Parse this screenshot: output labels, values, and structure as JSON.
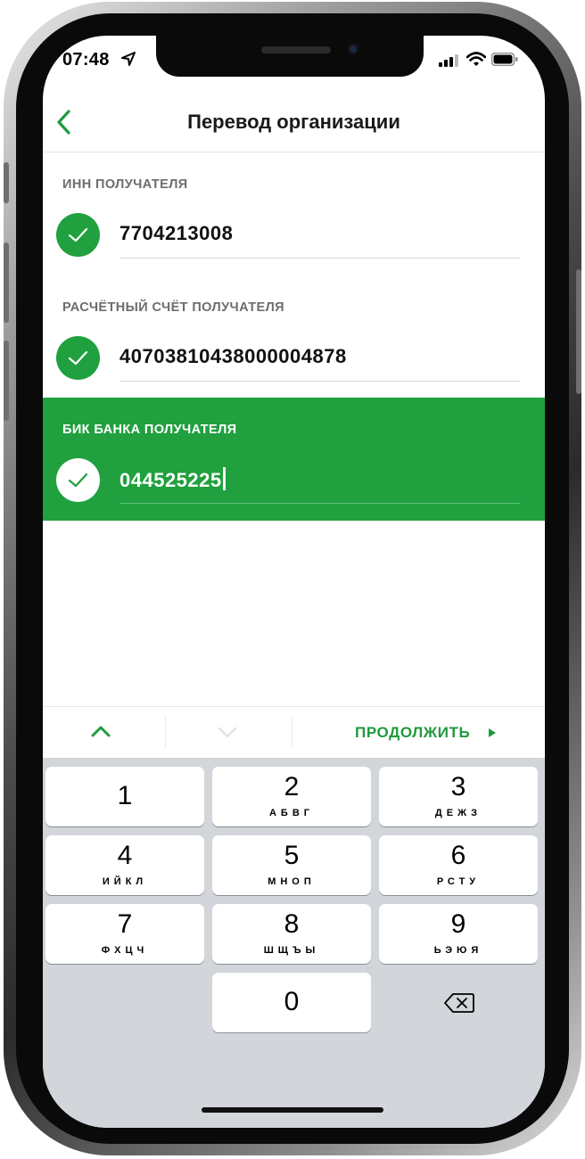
{
  "status_bar": {
    "time": "07:48"
  },
  "nav": {
    "title": "Перевод организации"
  },
  "fields": [
    {
      "label": "ИНН ПОЛУЧАТЕЛЯ",
      "value": "7704213008"
    },
    {
      "label": "РАСЧЁТНЫЙ СЧЁТ ПОЛУЧАТЕЛЯ",
      "value": "40703810438000004878"
    },
    {
      "label": "БИК БАНКА ПОЛУЧАТЕЛЯ",
      "value": "044525225"
    }
  ],
  "accessory": {
    "continue_label": "ПРОДОЛЖИТЬ"
  },
  "keypad": {
    "keys": [
      {
        "num": "1",
        "letters": ""
      },
      {
        "num": "2",
        "letters": "АБВГ"
      },
      {
        "num": "3",
        "letters": "ДЕЖЗ"
      },
      {
        "num": "4",
        "letters": "ИЙКЛ"
      },
      {
        "num": "5",
        "letters": "МНОП"
      },
      {
        "num": "6",
        "letters": "РСТУ"
      },
      {
        "num": "7",
        "letters": "ФХЦЧ"
      },
      {
        "num": "8",
        "letters": "ШЩЪЫ"
      },
      {
        "num": "9",
        "letters": "ЬЭЮЯ"
      },
      {
        "num": "0",
        "letters": ""
      }
    ]
  },
  "colors": {
    "accent_green": "#20a03e",
    "keypad_bg": "#d2d5da"
  },
  "icons": [
    "location-arrow-icon",
    "signal-icon",
    "wifi-icon",
    "battery-icon",
    "back-chevron-icon",
    "checkmark-icon",
    "chevron-up-icon",
    "chevron-down-icon",
    "triangle-right-icon",
    "backspace-icon"
  ]
}
